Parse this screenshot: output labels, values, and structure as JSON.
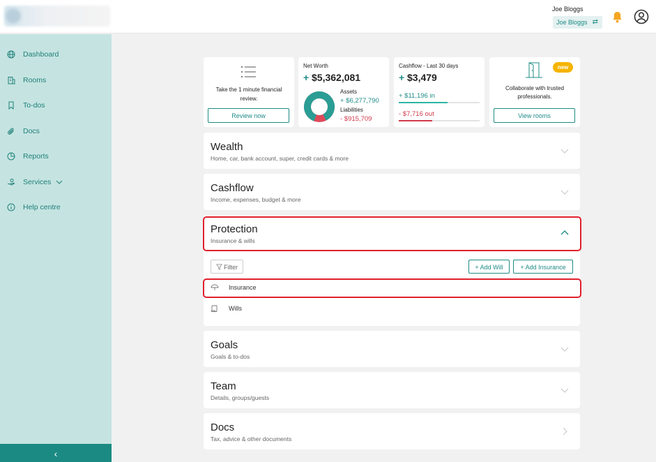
{
  "header": {
    "user_name": "Joe Bloggs",
    "account_switch_label": "Joe Bloggs",
    "swap_symbol": "⇄"
  },
  "sidebar": {
    "items": [
      {
        "label": "Dashboard",
        "icon": "globe-icon"
      },
      {
        "label": "Rooms",
        "icon": "building-icon"
      },
      {
        "label": "To-dos",
        "icon": "bookmark-icon"
      },
      {
        "label": "Docs",
        "icon": "paperclip-icon"
      },
      {
        "label": "Reports",
        "icon": "pie-chart-icon"
      },
      {
        "label": "Services",
        "icon": "hand-money-icon"
      },
      {
        "label": "Help centre",
        "icon": "info-icon"
      }
    ],
    "collapse_symbol": "‹"
  },
  "cards": {
    "review": {
      "text_line1": "Take the 1 minute financial",
      "text_line2": "review.",
      "button": "Review now"
    },
    "net_worth": {
      "label": "Net Worth",
      "sign": "+",
      "value": "$5,362,081",
      "assets_label": "Assets",
      "assets_value": "+ $6,277,790",
      "liabilities_label": "Liabilities",
      "liabilities_value": "- $915,709",
      "assets_share": 0.87
    },
    "cashflow": {
      "label": "Cashflow - Last 30 days",
      "sign": "+",
      "value": "$3,479",
      "in_value": "+ $11,196",
      "in_label": "in",
      "out_value": "- $7,716",
      "out_label": "out",
      "in_fraction": 0.6,
      "out_fraction": 0.41
    },
    "rooms": {
      "badge": "new",
      "text_line1": "Collaborate with trusted",
      "text_line2": "professionals.",
      "button": "View rooms"
    }
  },
  "sections": [
    {
      "title": "Wealth",
      "subtitle": "Home, car, bank account, super, credit cards & more",
      "state": "collapsed"
    },
    {
      "title": "Cashflow",
      "subtitle": "Income, expenses, budget & more",
      "state": "collapsed"
    },
    {
      "title": "Protection",
      "subtitle": "Insurance & wills",
      "state": "expanded"
    },
    {
      "title": "Goals",
      "subtitle": "Goals & to-dos",
      "state": "collapsed"
    },
    {
      "title": "Team",
      "subtitle": "Details, groups/guests",
      "state": "collapsed"
    },
    {
      "title": "Docs",
      "subtitle": "Tax, advice & other documents",
      "state": "link"
    }
  ],
  "protection": {
    "filter_label": "Filter",
    "add_will_label": "+ Add Will",
    "add_insurance_label": "+ Add Insurance",
    "items": [
      "Insurance",
      "Wills"
    ]
  },
  "colors": {
    "accent": "#1e8c86",
    "sidebar_bg": "#c5e4e1",
    "negative": "#d0394a",
    "highlight": "#e0202c",
    "badge": "#f5b400"
  }
}
